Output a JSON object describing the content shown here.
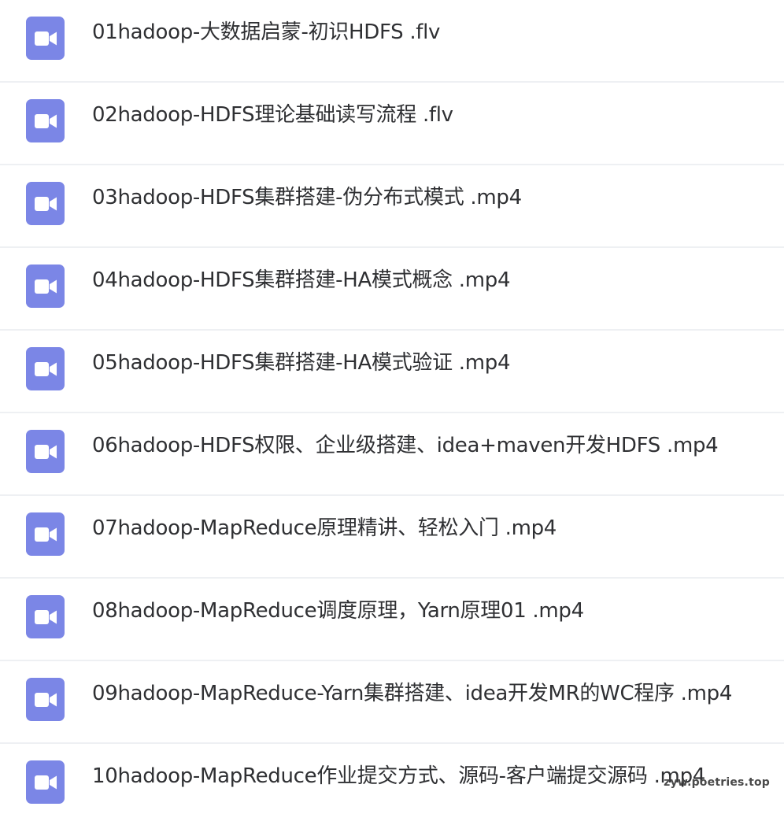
{
  "files": [
    {
      "name": "01hadoop-大数据启蒙-初识HDFS .flv",
      "icon": "video-file-icon"
    },
    {
      "name": "02hadoop-HDFS理论基础读写流程 .flv",
      "icon": "video-file-icon"
    },
    {
      "name": "03hadoop-HDFS集群搭建-伪分布式模式 .mp4",
      "icon": "video-file-icon"
    },
    {
      "name": "04hadoop-HDFS集群搭建-HA模式概念 .mp4",
      "icon": "video-file-icon"
    },
    {
      "name": "05hadoop-HDFS集群搭建-HA模式验证 .mp4",
      "icon": "video-file-icon"
    },
    {
      "name": "06hadoop-HDFS权限、企业级搭建、idea+maven开发HDFS .mp4",
      "icon": "video-file-icon"
    },
    {
      "name": "07hadoop-MapReduce原理精讲、轻松入门 .mp4",
      "icon": "video-file-icon"
    },
    {
      "name": "08hadoop-MapReduce调度原理，Yarn原理01 .mp4",
      "icon": "video-file-icon"
    },
    {
      "name": "09hadoop-MapReduce-Yarn集群搭建、idea开发MR的WC程序 .mp4",
      "icon": "video-file-icon"
    },
    {
      "name": "10hadoop-MapReduce作业提交方式、源码-客户端提交源码 .mp4",
      "icon": "video-file-icon"
    }
  ],
  "watermark": "zyw.poetries.top",
  "colors": {
    "icon_bg": "#7b86e6",
    "text": "#2f3033",
    "divider": "#eef0f3"
  }
}
